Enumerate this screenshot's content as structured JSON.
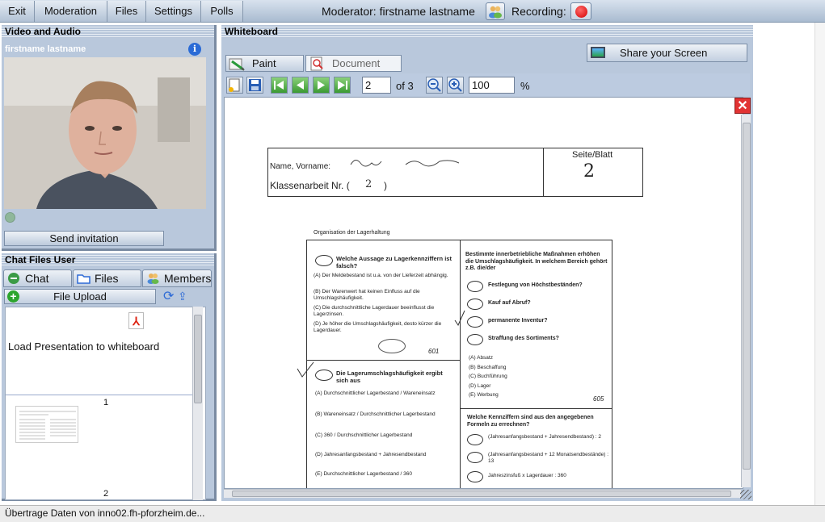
{
  "menu": {
    "items": [
      "Exit",
      "Moderation",
      "Files",
      "Settings",
      "Polls"
    ],
    "moderator_label": "Moderator: firstname lastname",
    "recording_label": "Recording:"
  },
  "video_panel": {
    "title": "Video and Audio",
    "user_name": "firstname lastname",
    "info_label": "i",
    "invite_button": "Send invitation"
  },
  "chat_panel": {
    "title": "Chat Files User",
    "tabs": [
      "Chat",
      "Files",
      "Members"
    ],
    "upload_button": "File Upload",
    "file_items": [
      {
        "label": "Load Presentation to whiteboard"
      },
      {
        "page_number": "1"
      },
      {
        "page_number": "2"
      }
    ]
  },
  "whiteboard": {
    "title": "Whiteboard",
    "tabs": [
      "Paint",
      "Document"
    ],
    "share_button": "Share your Screen",
    "page_current": "2",
    "page_total_label": "of 3",
    "zoom_value": "100",
    "zoom_unit": "%",
    "document": {
      "header_name_label": "Name, Vorname:",
      "header_class_label": "Klassenarbeit Nr. (",
      "header_class_close": ")",
      "header_page_label": "Seite/Blatt",
      "header_page_value": "2",
      "section_title": "Organisation der Lagerhaltung",
      "q1_title": "Welche Aussage zu Lagerkennziffern ist falsch?",
      "q1_options": [
        "(A) Der Meldebestand ist u.a. von der Lieferzeit abhängig.",
        "(B) Der Warenwert hat keinen Einfluss auf die Umschlagshäufigkeit.",
        "(C) Die durchschnittliche Lagerdauer beeinflusst die Lagerzinsen.",
        "(D) Je höher die Umschlagshäufigkeit, desto kürzer die Lagerdauer."
      ],
      "q1_number": "601",
      "q2_title": "Bestimmte innerbetriebliche Maßnahmen erhöhen die Umschlagshäufigkeit. In welchem Bereich gehört z.B. die/der",
      "q2_options": [
        "Festlegung von Höchstbeständen?",
        "Kauf auf Abruf?",
        "permanente Inventur?",
        "Straffung des Sortiments?"
      ],
      "q2_answers": [
        "(A) Absatz",
        "(B) Beschaffung",
        "(C) Buchführung",
        "(D) Lager",
        "(E) Werbung"
      ],
      "q2_number": "605",
      "q3_title": "Die Lagerumschlagshäufigkeit ergibt sich aus",
      "q3_options": [
        "(A) Durchschnittlicher Lagerbestand / Wareneinsatz",
        "(B) Wareneinsatz / Durchschnittlicher Lagerbestand",
        "(C) 360 / Durchschnittlicher Lagerbestand",
        "(D) Jahresanfangsbestand + Jahresendbestand",
        "(E) Durchschnittlicher Lagerbestand / 360"
      ],
      "q4_title": "Welche Kennziffern sind aus den angegebenen Formeln zu errechnen?",
      "q4_options": [
        "(Jahresanfangsbestand + Jahresendbestand) : 2",
        "(Jahresanfangsbestand + 12 Monatsendbestände) : 13",
        "Jahreszinsfuß x Lagerdauer : 360"
      ]
    }
  },
  "status_bar": {
    "text": "Übertrage Daten von inno02.fh-pforzheim.de..."
  }
}
